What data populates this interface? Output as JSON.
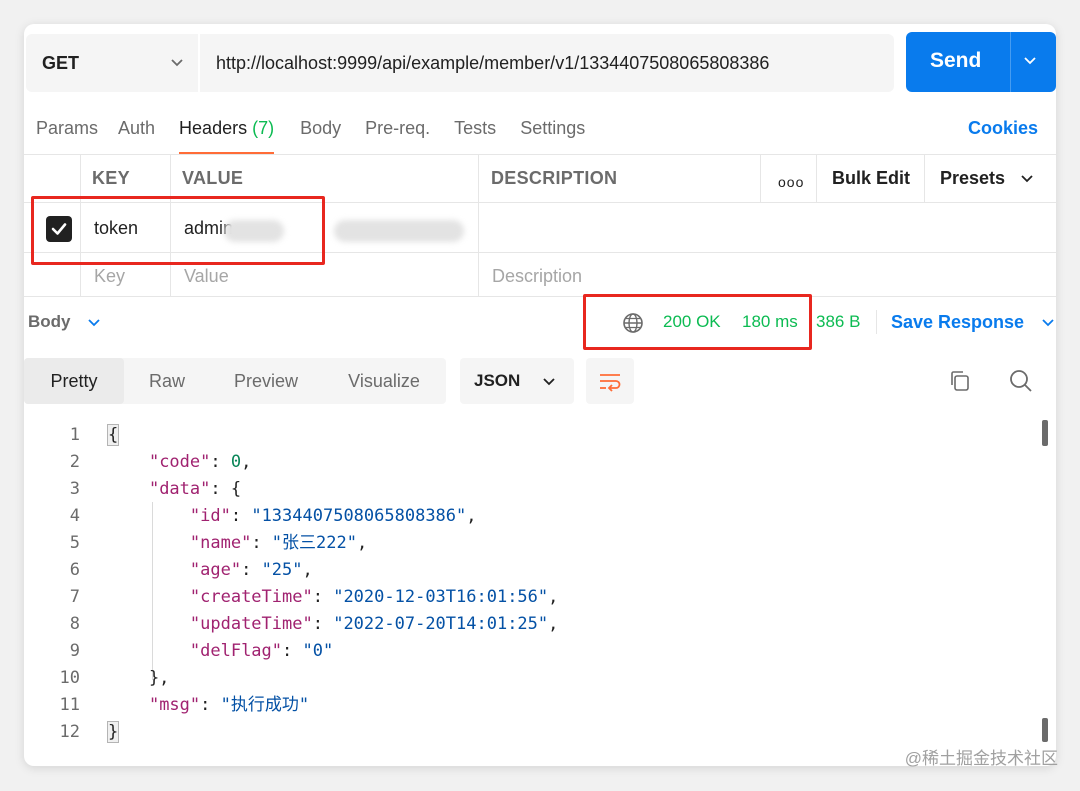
{
  "request": {
    "method": "GET",
    "url": "http://localhost:9999/api/example/member/v1/1334407508065808386",
    "send_label": "Send"
  },
  "tabs": [
    {
      "label": "Params"
    },
    {
      "label": "Auth"
    },
    {
      "label": "Headers",
      "count": "(7)",
      "active": true
    },
    {
      "label": "Body"
    },
    {
      "label": "Pre-req."
    },
    {
      "label": "Tests"
    },
    {
      "label": "Settings"
    }
  ],
  "cookies_label": "Cookies",
  "headers_table": {
    "columns": [
      "KEY",
      "VALUE",
      "DESCRIPTION"
    ],
    "more_label": "ooo",
    "bulk_edit_label": "Bulk Edit",
    "presets_label": "Presets",
    "rows": [
      {
        "checked": true,
        "key": "token",
        "value": "admin"
      }
    ],
    "placeholders": {
      "key": "Key",
      "value": "Value",
      "description": "Description"
    }
  },
  "response": {
    "section_label": "Body",
    "status": "200 OK",
    "time": "180 ms",
    "size": "386 B",
    "save_label": "Save Response",
    "view_tabs": [
      "Pretty",
      "Raw",
      "Preview",
      "Visualize"
    ],
    "active_view": "Pretty",
    "format": "JSON",
    "line_numbers": [
      "1",
      "2",
      "3",
      "4",
      "5",
      "6",
      "7",
      "8",
      "9",
      "10",
      "11",
      "12"
    ],
    "json": {
      "code_key": "\"code\"",
      "code_val": "0",
      "data_key": "\"data\"",
      "id_key": "\"id\"",
      "id_val": "\"1334407508065808386\"",
      "name_key": "\"name\"",
      "name_val": "\"张三222\"",
      "age_key": "\"age\"",
      "age_val": "\"25\"",
      "createTime_key": "\"createTime\"",
      "createTime_val": "\"2020-12-03T16:01:56\"",
      "updateTime_key": "\"updateTime\"",
      "updateTime_val": "\"2022-07-20T14:01:25\"",
      "delFlag_key": "\"delFlag\"",
      "delFlag_val": "\"0\"",
      "msg_key": "\"msg\"",
      "msg_val": "\"执行成功\""
    }
  },
  "watermark": "@稀土掘金技术社区",
  "colors": {
    "accent_blue": "#097bed",
    "success_green": "#0cbb52",
    "tab_underline": "#ff6c37",
    "highlight_red": "#e8271f"
  }
}
